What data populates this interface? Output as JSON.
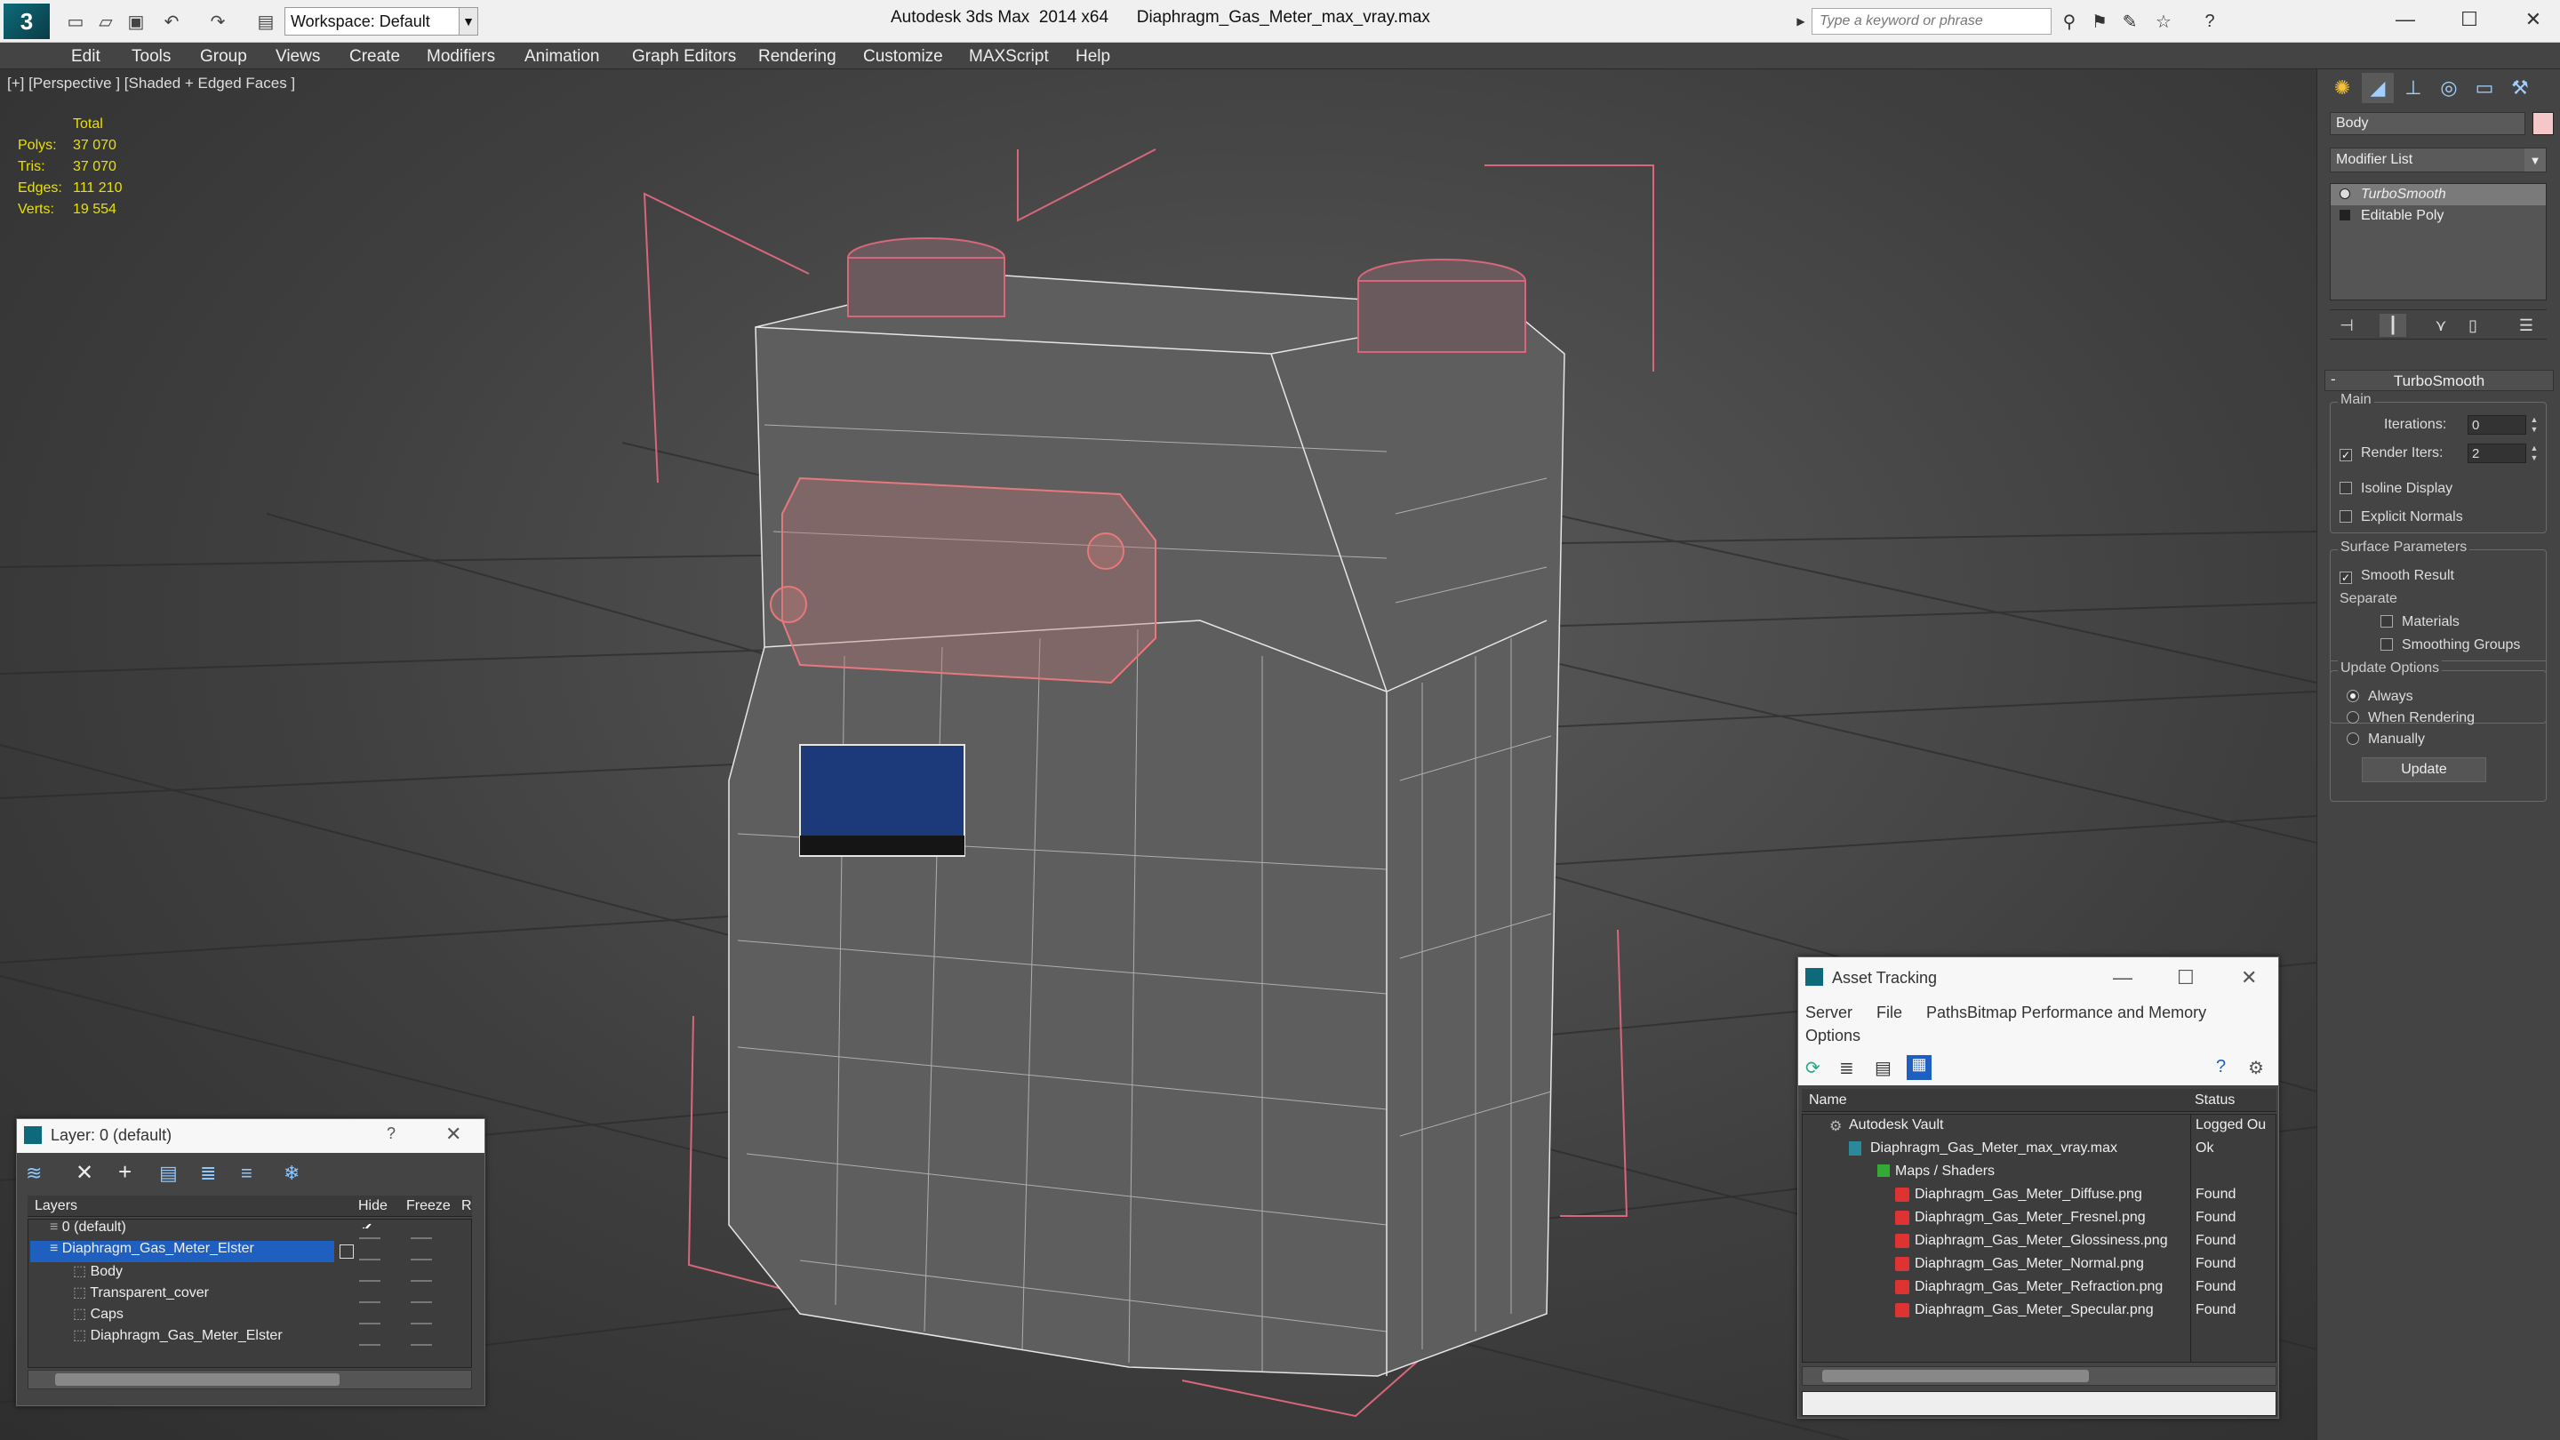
{
  "titlebar": {
    "workspace": "Workspace: Default",
    "app_title": "Autodesk 3ds Max  2014 x64",
    "file_name": "Diaphragm_Gas_Meter_max_vray.max",
    "search_placeholder": "Type a keyword or phrase"
  },
  "menu": [
    "Edit",
    "Tools",
    "Group",
    "Views",
    "Create",
    "Modifiers",
    "Animation",
    "Graph Editors",
    "Rendering",
    "Customize",
    "MAXScript",
    "Help"
  ],
  "viewport": {
    "label": "[+] [Perspective ] [Shaded + Edged Faces ]",
    "stats": {
      "header": "Total",
      "rows": [
        {
          "k": "Polys:",
          "v": "37 070"
        },
        {
          "k": "Tris:",
          "v": "37 070"
        },
        {
          "k": "Edges:",
          "v": "111 210"
        },
        {
          "k": "Verts:",
          "v": "19 554"
        }
      ]
    }
  },
  "command_panel": {
    "object_name": "Body",
    "modifier_list": "Modifier List",
    "stack": [
      "TurboSmooth",
      "Editable Poly"
    ],
    "rollout_title": "TurboSmooth",
    "main_group": "Main",
    "iterations_label": "Iterations:",
    "iterations_value": "0",
    "render_iters_label": "Render Iters:",
    "render_iters_value": "2",
    "isoline": "Isoline Display",
    "explicit": "Explicit Normals",
    "surface_group": "Surface Parameters",
    "smooth_result": "Smooth Result",
    "separate": "Separate",
    "materials": "Materials",
    "smoothing_groups": "Smoothing Groups",
    "update_group": "Update Options",
    "always": "Always",
    "when_rendering": "When Rendering",
    "manually": "Manually",
    "update_button": "Update"
  },
  "layers_dialog": {
    "title": "Layer: 0 (default)",
    "col_layers": "Layers",
    "col_hide": "Hide",
    "col_freeze": "Freeze",
    "col_extra": "R",
    "rows": [
      {
        "name": "0 (default)",
        "indent": 1,
        "sel": false,
        "active": true
      },
      {
        "name": "Diaphragm_Gas_Meter_Elster",
        "indent": 1,
        "sel": true,
        "active": false
      },
      {
        "name": "Body",
        "indent": 2,
        "sel": false,
        "active": false
      },
      {
        "name": "Transparent_cover",
        "indent": 2,
        "sel": false,
        "active": false
      },
      {
        "name": "Caps",
        "indent": 2,
        "sel": false,
        "active": false
      },
      {
        "name": "Diaphragm_Gas_Meter_Elster",
        "indent": 2,
        "sel": false,
        "active": false
      }
    ]
  },
  "asset_tracking": {
    "title": "Asset Tracking",
    "menu": [
      "Server",
      "File",
      "Paths",
      "Bitmap Performance and Memory"
    ],
    "menu2": "Options",
    "col_name": "Name",
    "col_status": "Status",
    "rows": [
      {
        "name": "Autodesk Vault",
        "status": "Logged Ou",
        "level": 0,
        "icon": "vault"
      },
      {
        "name": "Diaphragm_Gas_Meter_max_vray.max",
        "status": "Ok",
        "level": 1,
        "icon": "max"
      },
      {
        "name": "Maps / Shaders",
        "status": "",
        "level": 2,
        "icon": "folder"
      },
      {
        "name": "Diaphragm_Gas_Meter_Diffuse.png",
        "status": "Found",
        "level": 3,
        "icon": "png"
      },
      {
        "name": "Diaphragm_Gas_Meter_Fresnel.png",
        "status": "Found",
        "level": 3,
        "icon": "png"
      },
      {
        "name": "Diaphragm_Gas_Meter_Glossiness.png",
        "status": "Found",
        "level": 3,
        "icon": "png"
      },
      {
        "name": "Diaphragm_Gas_Meter_Normal.png",
        "status": "Found",
        "level": 3,
        "icon": "png"
      },
      {
        "name": "Diaphragm_Gas_Meter_Refraction.png",
        "status": "Found",
        "level": 3,
        "icon": "png"
      },
      {
        "name": "Diaphragm_Gas_Meter_Specular.png",
        "status": "Found",
        "level": 3,
        "icon": "png"
      }
    ]
  },
  "colors": {
    "selection": "#1e5fbf",
    "stats_yellow": "#e8e000",
    "bbox_pink": "#d8677c"
  }
}
